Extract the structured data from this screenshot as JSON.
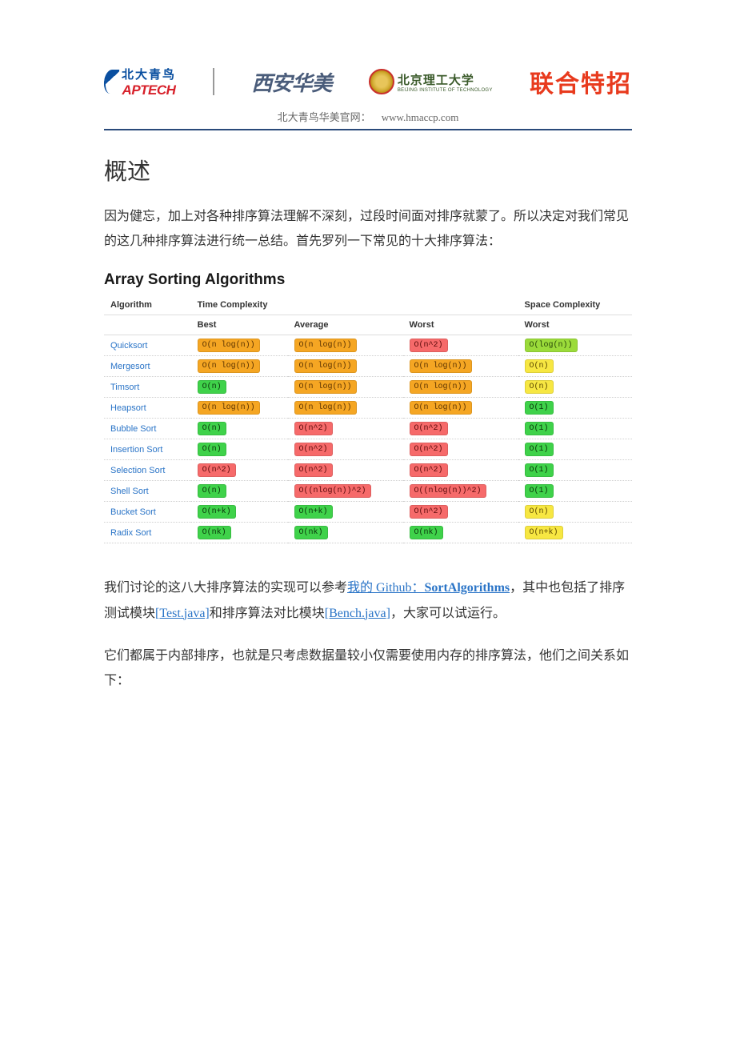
{
  "header": {
    "aptech_cn": "北大青鸟",
    "aptech_en": "APTECH",
    "huamei": "西安华美",
    "bit_cn": "北京理工大学",
    "bit_en": "BEIJING INSTITUTE OF TECHNOLOGY",
    "tezao": "联合特招",
    "sub_label": "北大青鸟华美官网：",
    "sub_url": "www.hmaccp.com"
  },
  "title": "概述",
  "para1": "因为健忘，加上对各种排序算法理解不深刻，过段时间面对排序就蒙了。所以决定对我们常见的这几种排序算法进行统一总结。首先罗列一下常见的十大排序算法：",
  "table_title": "Array Sorting Algorithms",
  "columns": {
    "algo": "Algorithm",
    "time": "Time Complexity",
    "space": "Space Complexity",
    "best": "Best",
    "avg": "Average",
    "worst": "Worst",
    "space_worst": "Worst"
  },
  "rows": [
    {
      "name": "Quicksort",
      "best": {
        "t": "O(n log(n))",
        "c": "orange"
      },
      "avg": {
        "t": "O(n log(n))",
        "c": "orange"
      },
      "worst": {
        "t": "O(n^2)",
        "c": "red"
      },
      "space": {
        "t": "O(log(n))",
        "c": "lime"
      }
    },
    {
      "name": "Mergesort",
      "best": {
        "t": "O(n log(n))",
        "c": "orange"
      },
      "avg": {
        "t": "O(n log(n))",
        "c": "orange"
      },
      "worst": {
        "t": "O(n log(n))",
        "c": "orange"
      },
      "space": {
        "t": "O(n)",
        "c": "yellow"
      }
    },
    {
      "name": "Timsort",
      "best": {
        "t": "O(n)",
        "c": "green"
      },
      "avg": {
        "t": "O(n log(n))",
        "c": "orange"
      },
      "worst": {
        "t": "O(n log(n))",
        "c": "orange"
      },
      "space": {
        "t": "O(n)",
        "c": "yellow"
      }
    },
    {
      "name": "Heapsort",
      "best": {
        "t": "O(n log(n))",
        "c": "orange"
      },
      "avg": {
        "t": "O(n log(n))",
        "c": "orange"
      },
      "worst": {
        "t": "O(n log(n))",
        "c": "orange"
      },
      "space": {
        "t": "O(1)",
        "c": "green"
      }
    },
    {
      "name": "Bubble Sort",
      "best": {
        "t": "O(n)",
        "c": "green"
      },
      "avg": {
        "t": "O(n^2)",
        "c": "red"
      },
      "worst": {
        "t": "O(n^2)",
        "c": "red"
      },
      "space": {
        "t": "O(1)",
        "c": "green"
      }
    },
    {
      "name": "Insertion Sort",
      "best": {
        "t": "O(n)",
        "c": "green"
      },
      "avg": {
        "t": "O(n^2)",
        "c": "red"
      },
      "worst": {
        "t": "O(n^2)",
        "c": "red"
      },
      "space": {
        "t": "O(1)",
        "c": "green"
      }
    },
    {
      "name": "Selection Sort",
      "best": {
        "t": "O(n^2)",
        "c": "red"
      },
      "avg": {
        "t": "O(n^2)",
        "c": "red"
      },
      "worst": {
        "t": "O(n^2)",
        "c": "red"
      },
      "space": {
        "t": "O(1)",
        "c": "green"
      }
    },
    {
      "name": "Shell Sort",
      "best": {
        "t": "O(n)",
        "c": "green"
      },
      "avg": {
        "t": "O((nlog(n))^2)",
        "c": "red"
      },
      "worst": {
        "t": "O((nlog(n))^2)",
        "c": "red"
      },
      "space": {
        "t": "O(1)",
        "c": "green"
      }
    },
    {
      "name": "Bucket Sort",
      "best": {
        "t": "O(n+k)",
        "c": "green"
      },
      "avg": {
        "t": "O(n+k)",
        "c": "green"
      },
      "worst": {
        "t": "O(n^2)",
        "c": "red"
      },
      "space": {
        "t": "O(n)",
        "c": "yellow"
      }
    },
    {
      "name": "Radix Sort",
      "best": {
        "t": "O(nk)",
        "c": "green"
      },
      "avg": {
        "t": "O(nk)",
        "c": "green"
      },
      "worst": {
        "t": "O(nk)",
        "c": "green"
      },
      "space": {
        "t": "O(n+k)",
        "c": "yellow"
      }
    }
  ],
  "para2_pre": "我们讨论的这八大排序算法的实现可以参考",
  "para2_link1": "我的 Github：",
  "para2_link1_bold": "SortAlgorithms",
  "para2_mid1": "，其中也包括了排序测试模块",
  "para2_link2": "[Test.java]",
  "para2_mid2": "和排序算法对比模块",
  "para2_link3": "[Bench.java]",
  "para2_end": "，大家可以试运行。",
  "para3": "它们都属于内部排序，也就是只考虑数据量较小仅需要使用内存的排序算法，他们之间关系如下：",
  "chart_data": {
    "type": "table",
    "title": "Array Sorting Algorithms",
    "columns": [
      "Algorithm",
      "Time Best",
      "Time Average",
      "Time Worst",
      "Space Worst"
    ],
    "rows": [
      [
        "Quicksort",
        "O(n log(n))",
        "O(n log(n))",
        "O(n^2)",
        "O(log(n))"
      ],
      [
        "Mergesort",
        "O(n log(n))",
        "O(n log(n))",
        "O(n log(n))",
        "O(n)"
      ],
      [
        "Timsort",
        "O(n)",
        "O(n log(n))",
        "O(n log(n))",
        "O(n)"
      ],
      [
        "Heapsort",
        "O(n log(n))",
        "O(n log(n))",
        "O(n log(n))",
        "O(1)"
      ],
      [
        "Bubble Sort",
        "O(n)",
        "O(n^2)",
        "O(n^2)",
        "O(1)"
      ],
      [
        "Insertion Sort",
        "O(n)",
        "O(n^2)",
        "O(n^2)",
        "O(1)"
      ],
      [
        "Selection Sort",
        "O(n^2)",
        "O(n^2)",
        "O(n^2)",
        "O(1)"
      ],
      [
        "Shell Sort",
        "O(n)",
        "O((nlog(n))^2)",
        "O((nlog(n))^2)",
        "O(1)"
      ],
      [
        "Bucket Sort",
        "O(n+k)",
        "O(n+k)",
        "O(n^2)",
        "O(n)"
      ],
      [
        "Radix Sort",
        "O(nk)",
        "O(nk)",
        "O(nk)",
        "O(n+k)"
      ]
    ]
  }
}
